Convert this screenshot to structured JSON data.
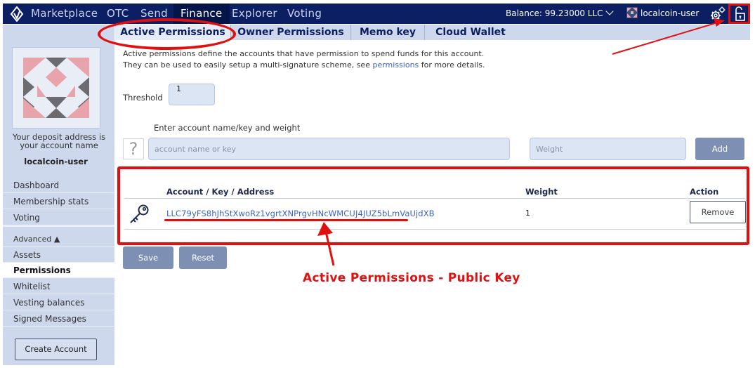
{
  "nav": {
    "items": [
      "Marketplace",
      "OTC",
      "Send",
      "Finance",
      "Explorer",
      "Voting"
    ],
    "active": "Finance",
    "balance": "Balance: 99.23000 LLC",
    "account_name": "localcoin-user"
  },
  "subtabs": [
    "Active Permissions",
    "Owner Permissions",
    "Memo key",
    "Cloud Wallet"
  ],
  "sidebar": {
    "deposit_note": "Your deposit address is your account name",
    "username": "localcoin-user",
    "items": [
      "Dashboard",
      "Membership stats",
      "Voting",
      "Advanced ▲",
      "Assets",
      "Permissions",
      "Whitelist",
      "Vesting balances",
      "Signed Messages"
    ],
    "create_account": "Create Account"
  },
  "main": {
    "desc_line1": "Active permissions define the accounts that have permission to spend funds for this account.",
    "desc_line2_prefix": "They can be used to easily setup a multi-signature scheme, see",
    "desc_link": "permissions",
    "desc_line2_suffix": "for more details.",
    "threshold_label": "Threshold",
    "threshold_value": "1",
    "enter_label": "Enter account name/key and weight",
    "qmark": "?",
    "account_placeholder": "account name or key",
    "weight_placeholder": "Weight",
    "add_label": "Add",
    "table": {
      "headers": [
        "Account / Key / Address",
        "Weight",
        "Action"
      ],
      "row": {
        "key": "LLC79yFS8hJhStXwoRz1vgrtXNPrgvHNcWMCUJ4JUZ5bLmVaUjdXB",
        "weight": "1",
        "action": "Remove"
      }
    },
    "save_label": "Save",
    "reset_label": "Reset",
    "annotation": "Active Permissions - Public Key"
  },
  "colors": {
    "nav_bg": "#0d1f63",
    "sidebar_bg": "#cdd8ec",
    "accent_red": "#e01010",
    "link_blue": "#3d62c4"
  }
}
